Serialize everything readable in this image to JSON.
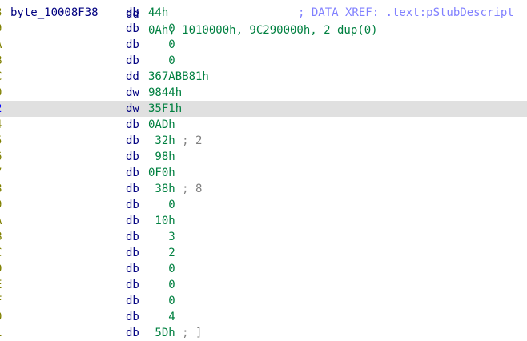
{
  "top_partial": {
    "address": "",
    "mnemonic": "dd",
    "operand": "0Ah, 1010000h, 9C290000h, 2 dup(0)"
  },
  "lines": [
    {
      "address": "3",
      "name": "byte_10008F38",
      "mnemonic": "db",
      "operand": "44h",
      "comment": "",
      "xref": "; DATA XREF: .text:pStubDescript",
      "current": false
    },
    {
      "address": "9",
      "name": "",
      "mnemonic": "db",
      "operand": "   0",
      "comment": "",
      "xref": "",
      "current": false
    },
    {
      "address": "A",
      "name": "",
      "mnemonic": "db",
      "operand": "   0",
      "comment": "",
      "xref": "",
      "current": false
    },
    {
      "address": "B",
      "name": "",
      "mnemonic": "db",
      "operand": "   0",
      "comment": "",
      "xref": "",
      "current": false
    },
    {
      "address": "C",
      "name": "",
      "mnemonic": "dd",
      "operand": "367ABB81h",
      "comment": "",
      "xref": "",
      "current": false
    },
    {
      "address": "0",
      "name": "",
      "mnemonic": "dw",
      "operand": "9844h",
      "comment": "",
      "xref": "",
      "current": false
    },
    {
      "address": "2",
      "name": "",
      "mnemonic": "dw",
      "operand": "35F1h",
      "comment": "",
      "xref": "",
      "current": true
    },
    {
      "address": "4",
      "name": "",
      "mnemonic": "db",
      "operand": "0ADh",
      "comment": "",
      "xref": "",
      "current": false
    },
    {
      "address": "5",
      "name": "",
      "mnemonic": "db",
      "operand": " 32h",
      "comment": " ; 2",
      "xref": "",
      "current": false
    },
    {
      "address": "6",
      "name": "",
      "mnemonic": "db",
      "operand": " 98h",
      "comment": "",
      "xref": "",
      "current": false
    },
    {
      "address": "7",
      "name": "",
      "mnemonic": "db",
      "operand": "0F0h",
      "comment": "",
      "xref": "",
      "current": false
    },
    {
      "address": "8",
      "name": "",
      "mnemonic": "db",
      "operand": " 38h",
      "comment": " ; 8",
      "xref": "",
      "current": false
    },
    {
      "address": "9",
      "name": "",
      "mnemonic": "db",
      "operand": "   0",
      "comment": "",
      "xref": "",
      "current": false
    },
    {
      "address": "A",
      "name": "",
      "mnemonic": "db",
      "operand": " 10h",
      "comment": "",
      "xref": "",
      "current": false
    },
    {
      "address": "B",
      "name": "",
      "mnemonic": "db",
      "operand": "   3",
      "comment": "",
      "xref": "",
      "current": false
    },
    {
      "address": "C",
      "name": "",
      "mnemonic": "db",
      "operand": "   2",
      "comment": "",
      "xref": "",
      "current": false
    },
    {
      "address": "D",
      "name": "",
      "mnemonic": "db",
      "operand": "   0",
      "comment": "",
      "xref": "",
      "current": false
    },
    {
      "address": "E",
      "name": "",
      "mnemonic": "db",
      "operand": "   0",
      "comment": "",
      "xref": "",
      "current": false
    },
    {
      "address": "F",
      "name": "",
      "mnemonic": "db",
      "operand": "   0",
      "comment": "",
      "xref": "",
      "current": false
    },
    {
      "address": "0",
      "name": "",
      "mnemonic": "db",
      "operand": "   4",
      "comment": "",
      "xref": "",
      "current": false
    },
    {
      "address": "1",
      "name": "",
      "mnemonic": "db",
      "operand": " 5Dh",
      "comment": " ; ]",
      "xref": "",
      "current": false
    }
  ]
}
